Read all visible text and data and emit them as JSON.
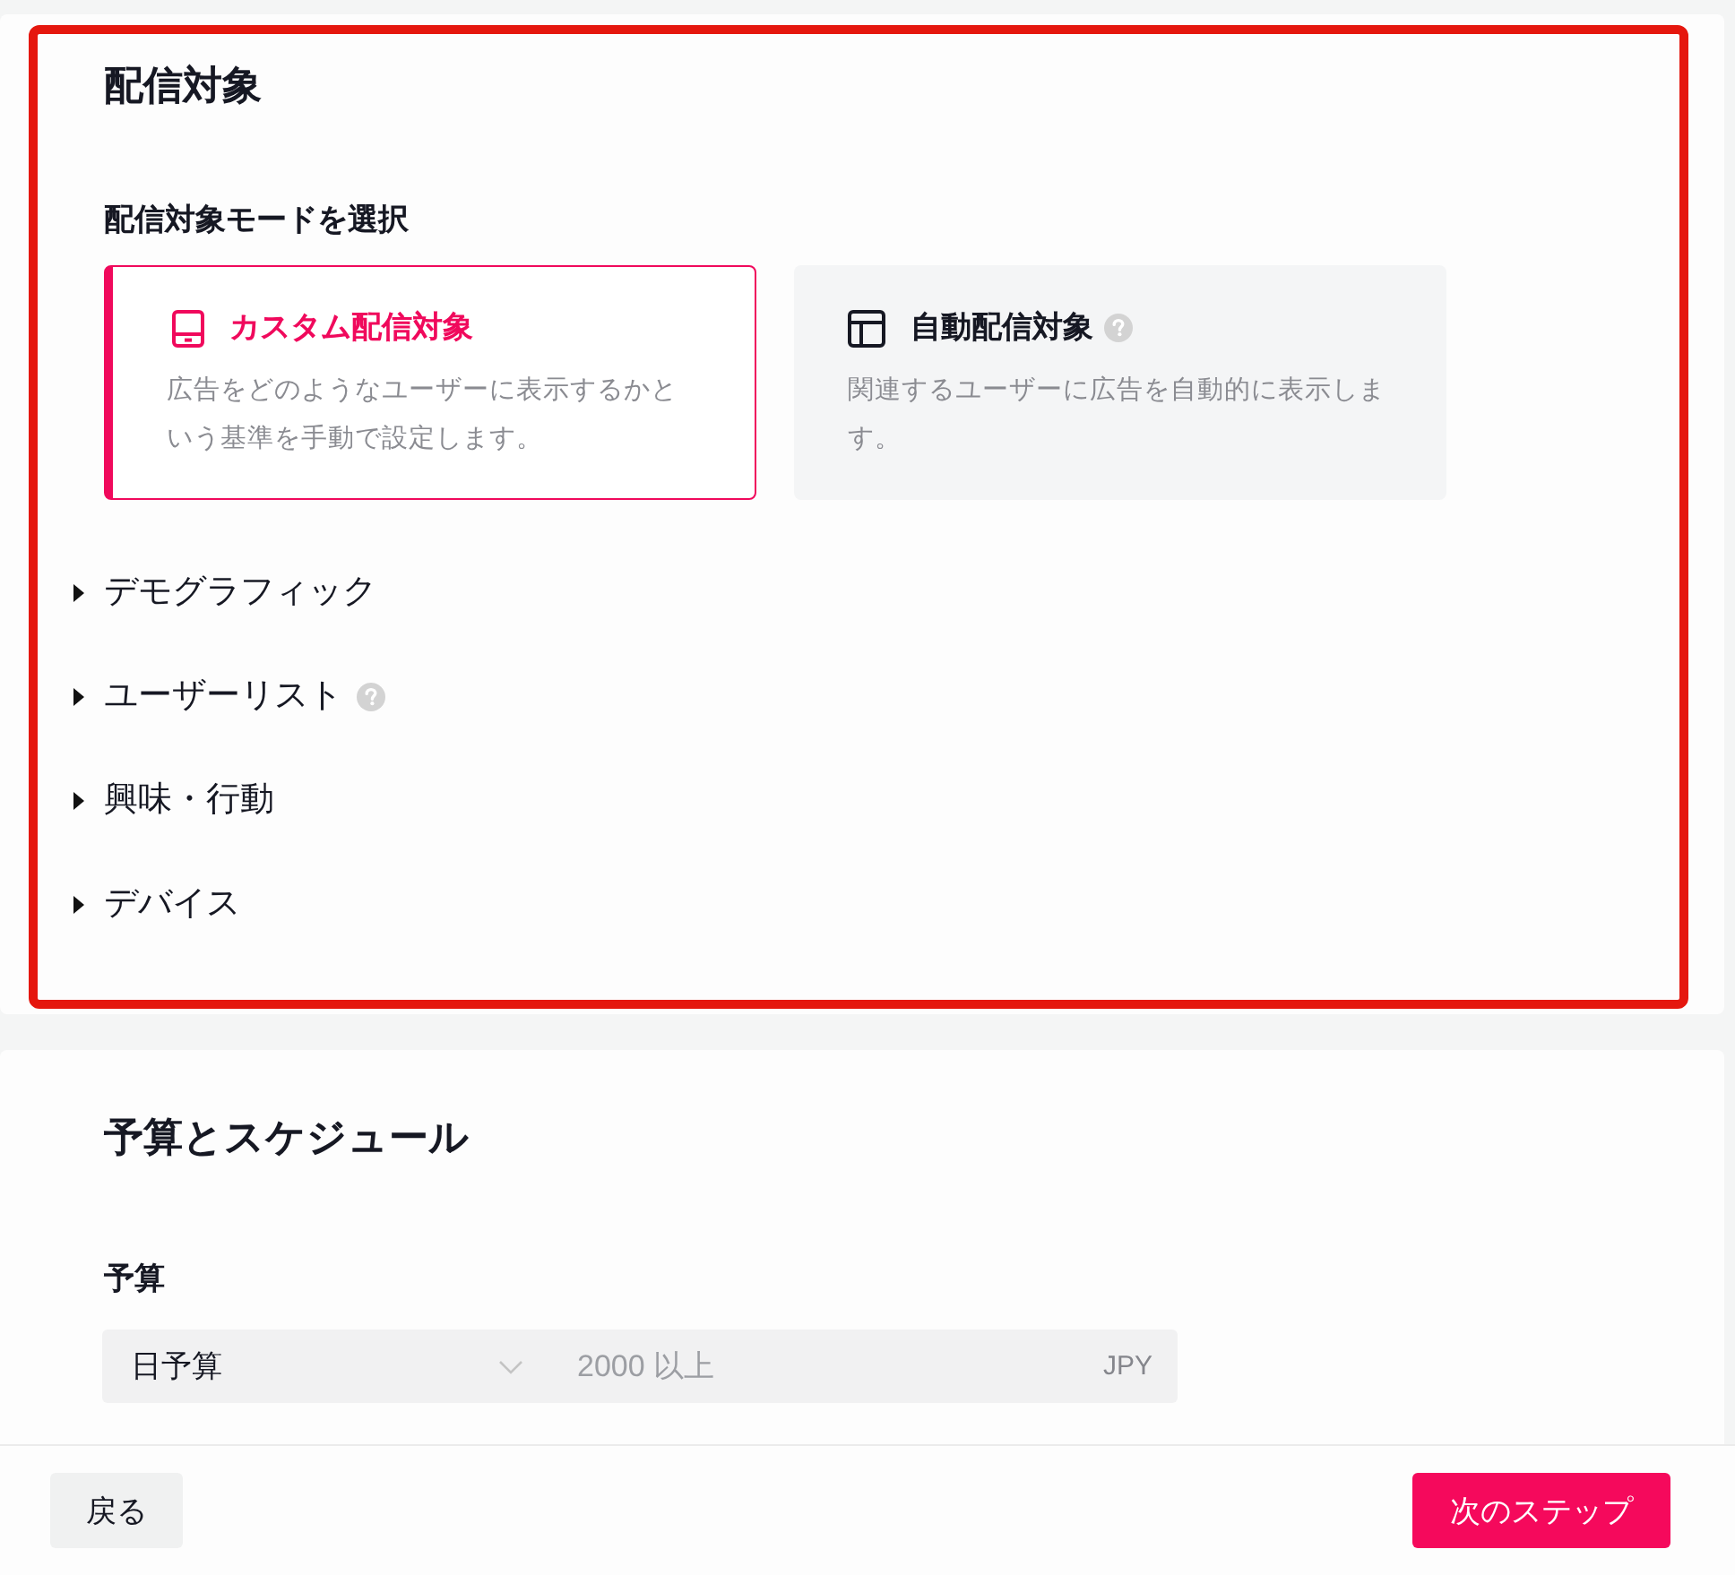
{
  "targeting": {
    "title": "配信対象",
    "highlighted": true,
    "mode_label": "配信対象モードを選択",
    "modes": [
      {
        "kind": "custom",
        "title": "カスタム配信対象",
        "description": "広告をどのようなユーザーに表示するかという基準を手動で設定します。",
        "help": false,
        "selected": true
      },
      {
        "kind": "auto",
        "title": "自動配信対象",
        "description": "関連するユーザーに広告を自動的に表示します。",
        "help": true,
        "selected": false
      }
    ],
    "sections": [
      {
        "label": "デモグラフィック",
        "help": false,
        "expanded": false
      },
      {
        "label": "ユーザーリスト",
        "help": true,
        "expanded": false
      },
      {
        "label": "興味・行動",
        "help": false,
        "expanded": false
      },
      {
        "label": "デバイス",
        "help": false,
        "expanded": false
      }
    ]
  },
  "budget_schedule": {
    "title": "予算とスケジュール",
    "budget_label": "予算",
    "budget_type": "日予算",
    "amount": {
      "placeholder": "2000 以上"
    },
    "currency": "JPY"
  },
  "footer": {
    "back": "戻る",
    "next": "次のステップ"
  }
}
